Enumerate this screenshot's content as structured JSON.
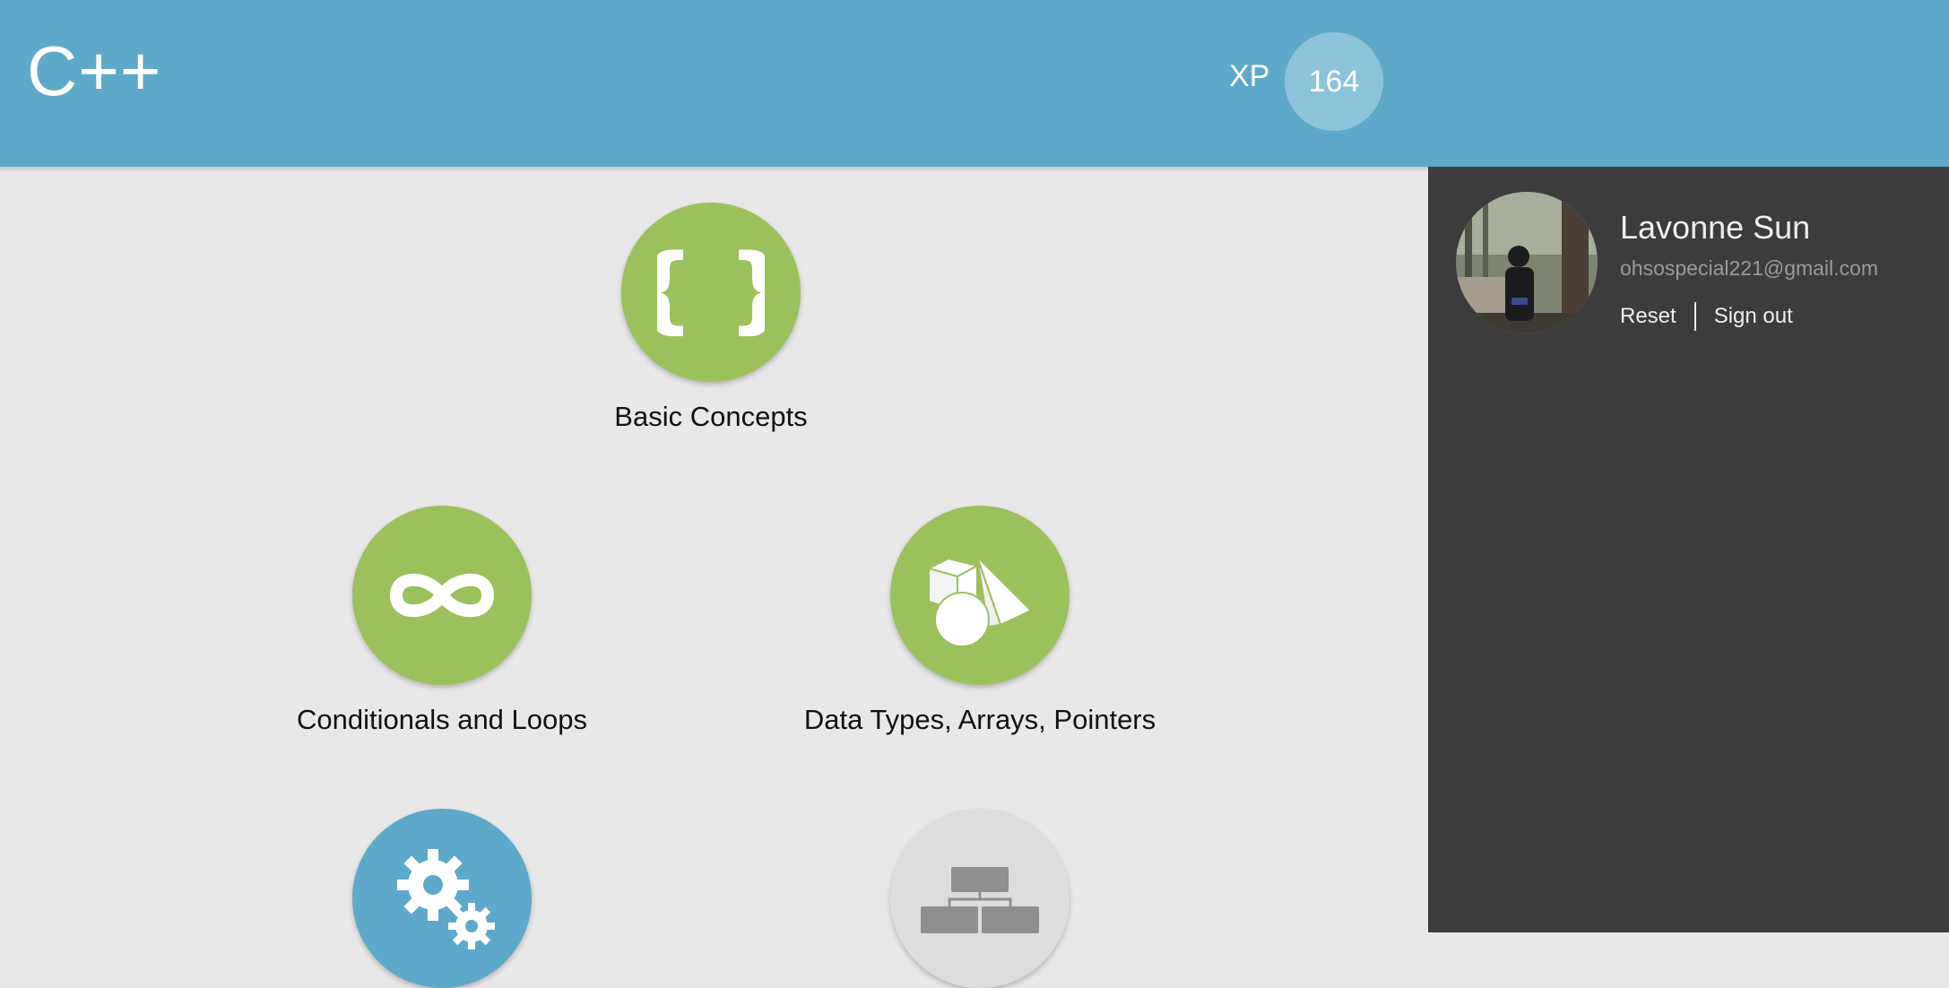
{
  "header": {
    "title": "C++",
    "xp_label": "XP",
    "xp_value": "164",
    "color": "#5ea9c9"
  },
  "profile": {
    "name": "Lavonne Sun",
    "email": "ohsospecial221@gmail.com",
    "reset_label": "Reset",
    "signout_label": "Sign out"
  },
  "modules": [
    {
      "label": "Basic Concepts",
      "icon": "curly-braces-icon",
      "status": "completed",
      "color": "#9bc15d"
    },
    {
      "label": "Conditionals and Loops",
      "icon": "infinity-icon",
      "status": "completed",
      "color": "#9bc15d"
    },
    {
      "label": "Data Types, Arrays, Pointers",
      "icon": "shapes-icon",
      "status": "completed",
      "color": "#9bc15d"
    },
    {
      "label": "",
      "icon": "gears-icon",
      "status": "current",
      "color": "#5ea9c9"
    },
    {
      "label": "",
      "icon": "hierarchy-icon",
      "status": "locked",
      "color": "#dddddd"
    }
  ],
  "colors": {
    "background": "#e8e8e8",
    "sidebar": "#3c3c3c",
    "completed": "#9bc15d",
    "current": "#5ea9c9",
    "locked": "#dddddd"
  }
}
